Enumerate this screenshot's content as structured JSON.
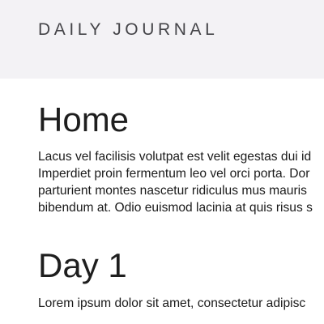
{
  "header": {
    "site_title": "DAILY JOURNAL"
  },
  "sections": [
    {
      "heading": "Home",
      "lines": [
        "Lacus vel facilisis volutpat est velit egestas dui id",
        "Imperdiet proin fermentum leo vel orci porta. Dor",
        "parturient montes nascetur ridiculus mus mauris",
        "bibendum at. Odio euismod lacinia at quis risus s"
      ]
    },
    {
      "heading": "Day 1",
      "lines": [
        "Lorem ipsum dolor sit amet, consectetur adipisc"
      ]
    }
  ],
  "colors": {
    "header_background": "#f3f2f5",
    "header_text": "#444448",
    "body_text": "#1a1a1a",
    "page_background": "#ffffff"
  }
}
